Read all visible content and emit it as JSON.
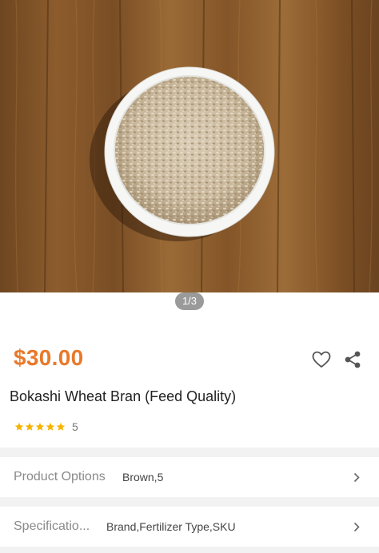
{
  "gallery": {
    "counter": "1/3"
  },
  "product": {
    "price": "$30.00",
    "title": "Bokashi Wheat Bran (Feed Quality)",
    "rating_stars": 5,
    "rating_count": "5"
  },
  "options": {
    "product_options_label": "Product Options",
    "product_options_value": "Brown,5",
    "specification_label": "Specificatio...",
    "specification_value": "Brand,Fertilizer Type,SKU"
  },
  "colors": {
    "price": "#e8792a",
    "star": "#f5b400",
    "wood": "#8a5a2b",
    "bowl": "#f4f4f2"
  },
  "icons": [
    "heart-icon",
    "share-icon",
    "star-icon",
    "chevron-right-icon"
  ]
}
